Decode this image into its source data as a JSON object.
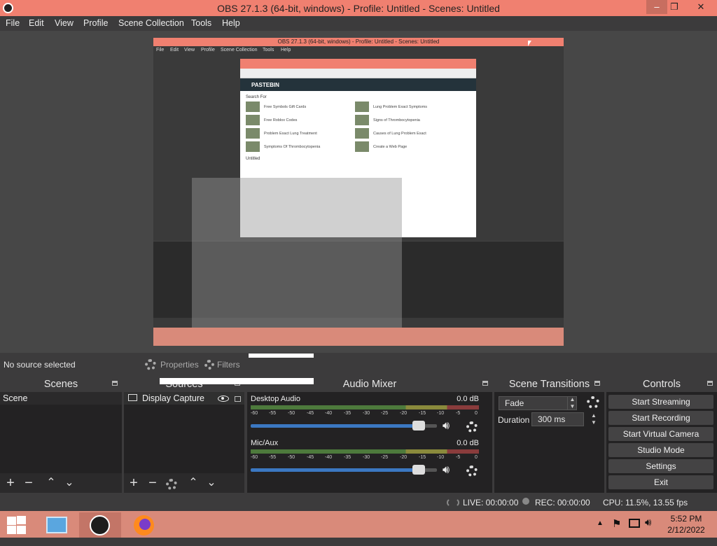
{
  "window": {
    "title": "OBS 27.1.3 (64-bit, windows) - Profile: Untitled - Scenes: Untitled",
    "minimize": "–",
    "maximize": "❐",
    "close": "✕"
  },
  "menu": [
    "File",
    "Edit",
    "View",
    "Profile",
    "Scene Collection",
    "Tools",
    "Help"
  ],
  "preview": {
    "nested_title": "OBS 27.1.3 (64-bit, windows) - Profile: Untitled - Scenes: Untitled",
    "nested_menu": [
      "File",
      "Edit",
      "View",
      "Profile",
      "Scene Collection",
      "Tools",
      "Help"
    ],
    "browser_brand": "PASTEBIN",
    "search_for": "Search For",
    "links": [
      "Free Symbols Gift Cards",
      "Lung Problem Exact Symptoms",
      "Free Roblox Codes",
      "Signs of Thrombocytopenia",
      "Problem Exact Lung Treatment",
      "Causes of Lung Problem Exact",
      "Symptoms Of Thrombocytopenia",
      "Create a Web Page"
    ],
    "untitled": "Untitled"
  },
  "source_bar": {
    "no_source": "No source selected",
    "properties": "Properties",
    "filters": "Filters"
  },
  "scenes": {
    "title": "Scenes",
    "items": [
      "Scene"
    ]
  },
  "sources": {
    "title": "Sources",
    "items": [
      "Display Capture"
    ]
  },
  "mixer": {
    "title": "Audio Mixer",
    "channels": [
      {
        "name": "Desktop Audio",
        "db": "0.0 dB",
        "volume": 0.92
      },
      {
        "name": "Mic/Aux",
        "db": "0.0 dB",
        "volume": 0.92
      }
    ],
    "ticks": [
      "-60",
      "-55",
      "-50",
      "-45",
      "-40",
      "-35",
      "-30",
      "-25",
      "-20",
      "-15",
      "-10",
      "-5",
      "0"
    ]
  },
  "transitions": {
    "title": "Scene Transitions",
    "selected": "Fade",
    "duration_label": "Duration",
    "duration_value": "300 ms"
  },
  "controls": {
    "title": "Controls",
    "buttons": [
      "Start Streaming",
      "Start Recording",
      "Start Virtual Camera",
      "Studio Mode",
      "Settings",
      "Exit"
    ]
  },
  "status": {
    "live": "LIVE: 00:00:00",
    "rec": "REC: 00:00:00",
    "cpu": "CPU: 11.5%, 13.55 fps"
  },
  "taskbar": {
    "time": "5:52 PM",
    "date": "2/12/2022"
  },
  "colors": {
    "titlebar": "#f08070",
    "taskbar": "#d98a7a",
    "panel_bg": "#2b2a2b",
    "fader": "#3b78c2"
  }
}
